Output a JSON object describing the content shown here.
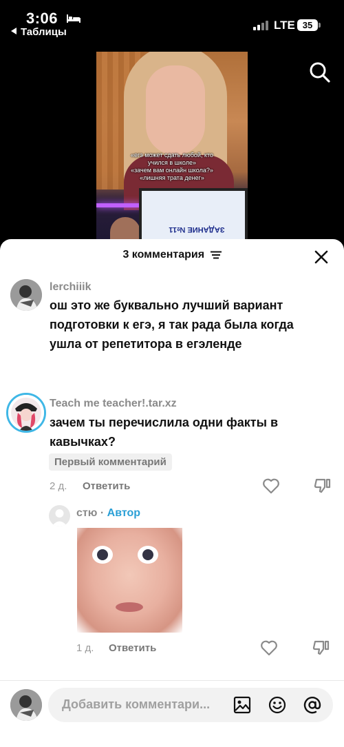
{
  "status_bar": {
    "time": "3:06",
    "back_app": "Таблицы",
    "network": "LTE",
    "battery": "35"
  },
  "video": {
    "caption": [
      "«егэ может сдать любой, кто",
      "учился в школе»",
      "«зачем вам онлайн школа?»",
      "«лишняя трата денег»"
    ],
    "monitor_text": "ЗАДАНИЕ №11"
  },
  "sheet": {
    "title": "3 комментария"
  },
  "comments": [
    {
      "username": "lerchiiik",
      "lines": [
        "ош это же буквально лучший вариант",
        "подготовки к егэ, я так рада была когда",
        "ушла от репетитора в егэленде"
      ]
    },
    {
      "username": "Teach me teacher!.tar.xz",
      "lines": [
        "зачем ты перечислила одни факты в",
        "кавычках?"
      ],
      "pill": "Первый комментарий",
      "age": "2 д.",
      "reply": "Ответить"
    }
  ],
  "reply": {
    "username": "стю",
    "separator": "·",
    "badge": "Автор",
    "age": "1 д.",
    "reply": "Ответить"
  },
  "bottom": {
    "placeholder": "Добавить комментари..."
  },
  "icons": [
    "bed-icon",
    "signal-icon",
    "search-icon",
    "filter-icon",
    "close-icon",
    "heart-icon",
    "dislike-icon",
    "image-icon",
    "emoji-icon",
    "mention-icon"
  ],
  "colors": {
    "author_badge": "#2a9fd6",
    "avatar_ring": "#3fb7e6"
  }
}
